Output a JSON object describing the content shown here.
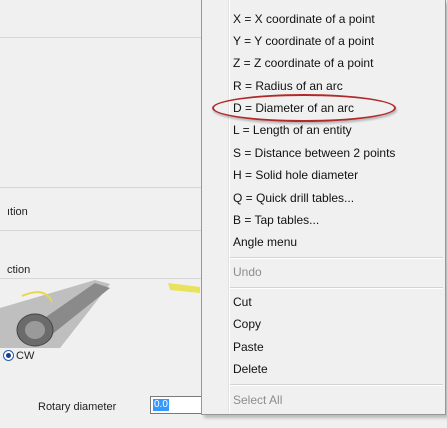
{
  "background": {
    "option_label": "ıtion",
    "direction_label": "ction",
    "cw_label": "CW",
    "rotary_label": "Rotary diameter",
    "rotary_value": "0.0"
  },
  "menu": {
    "items": [
      {
        "label": "X = X coordinate of a point",
        "disabled": false
      },
      {
        "label": "Y = Y coordinate of a point",
        "disabled": false
      },
      {
        "label": "Z = Z coordinate of a point",
        "disabled": false
      },
      {
        "label": "R = Radius of an arc",
        "disabled": false
      },
      {
        "label": "D = Diameter of an arc",
        "disabled": false,
        "highlighted": true
      },
      {
        "label": "L = Length of an entity",
        "disabled": false
      },
      {
        "label": "S = Distance between 2 points",
        "disabled": false
      },
      {
        "label": "H = Solid hole diameter",
        "disabled": false
      },
      {
        "label": "Q = Quick drill tables...",
        "disabled": false
      },
      {
        "label": "B = Tap tables...",
        "disabled": false
      },
      {
        "label": "Angle menu",
        "disabled": false
      },
      {
        "label": "Undo",
        "disabled": true
      },
      {
        "label": "Cut",
        "disabled": false
      },
      {
        "label": "Copy",
        "disabled": false
      },
      {
        "label": "Paste",
        "disabled": false
      },
      {
        "label": "Delete",
        "disabled": false
      },
      {
        "label": "Select All",
        "disabled": true
      }
    ]
  },
  "colors": {
    "highlight_oval": "#b12a2a",
    "selection": "#3399ff"
  }
}
